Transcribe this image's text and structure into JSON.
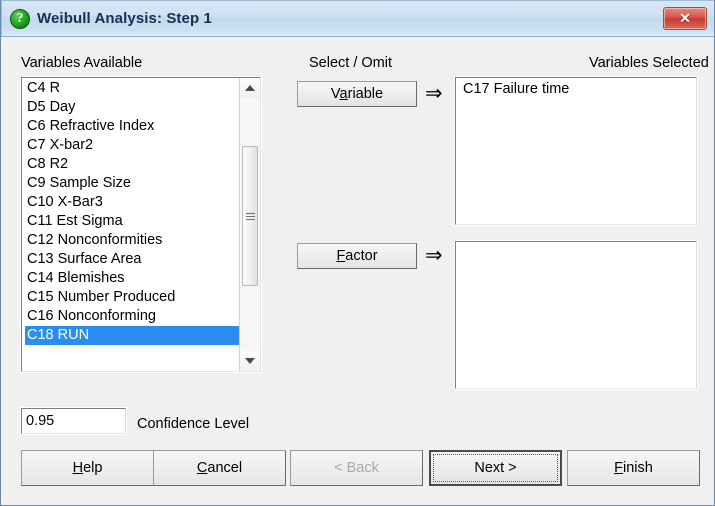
{
  "window": {
    "title": "Weibull Analysis: Step 1",
    "icon": "question-mark-icon",
    "icon_glyph": "?",
    "close_glyph": "✕",
    "bg_color": "#f0f0f0",
    "title_color": "#16314d",
    "accent_selection_color": "#2a8ef0",
    "close_color": "#d9544a"
  },
  "labels": {
    "variables_available": "Variables Available",
    "select_omit": "Select / Omit",
    "variables_selected": "Variables Selected",
    "confidence_level": "Confidence Level"
  },
  "variables_available": {
    "items": [
      "C4 R",
      "D5 Day",
      "C6 Refractive Index",
      "C7 X-bar2",
      "C8 R2",
      "C9 Sample Size",
      "C10 X-Bar3",
      "C11 Est Sigma",
      "C12 Nonconformities",
      "C13 Surface Area",
      "C14 Blemishes",
      "C15 Number Produced",
      "C16 Nonconforming",
      "C18 RUN"
    ],
    "selected_index": 13
  },
  "transfer": {
    "variable_button": "Variable",
    "variable_button_accel": "a",
    "factor_button": "Factor",
    "factor_button_accel": "F",
    "arrow_glyph": "⇒"
  },
  "variables_selected": {
    "items": [
      "C17 Failure time"
    ]
  },
  "factors_selected": {
    "items": []
  },
  "confidence": {
    "value": "0.95",
    "placeholder": "0.95"
  },
  "buttons": {
    "help": {
      "label": "Help",
      "accel": "H",
      "enabled": true
    },
    "cancel": {
      "label": "Cancel",
      "accel": "C",
      "enabled": true
    },
    "back": {
      "label": "< Back",
      "enabled": false
    },
    "next": {
      "label": "Next >",
      "enabled": true,
      "default": true
    },
    "finish": {
      "label": "Finish",
      "accel": "F",
      "enabled": true
    }
  }
}
